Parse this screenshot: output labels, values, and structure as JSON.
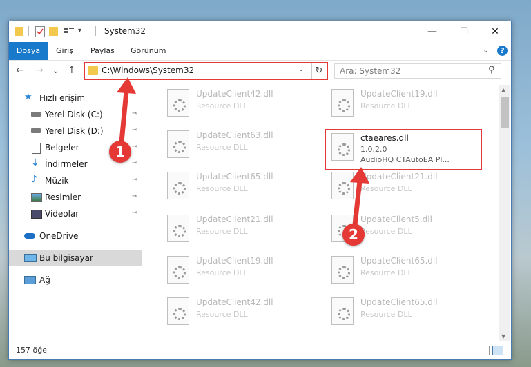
{
  "window": {
    "title": "System32",
    "qa_dropdown": "▾",
    "min": "—",
    "max": "☐",
    "close": "✕"
  },
  "ribbon": {
    "tabs": [
      "Dosya",
      "Giriş",
      "Paylaş",
      "Görünüm"
    ],
    "help": "?",
    "collapse": "⌄"
  },
  "nav": {
    "back": "←",
    "forward": "→",
    "recent": "⌄",
    "up": "↑",
    "address": "C:\\Windows\\System32",
    "address_dropdown": "⌄",
    "refresh": "↻",
    "search_placeholder": "Ara: System32",
    "search_icon": "⚲"
  },
  "sidebar": {
    "items": [
      {
        "label": "Hızlı erişim",
        "icon": "star-icon"
      },
      {
        "label": "Yerel Disk (C:)",
        "icon": "drive-icon"
      },
      {
        "label": "Yerel Disk (D:)",
        "icon": "drive-icon"
      },
      {
        "label": "Belgeler",
        "icon": "documents-icon"
      },
      {
        "label": "İndirmeler",
        "icon": "download-icon"
      },
      {
        "label": "Müzik",
        "icon": "music-icon"
      },
      {
        "label": "Resimler",
        "icon": "pictures-icon"
      },
      {
        "label": "Videolar",
        "icon": "videos-icon"
      },
      {
        "label": "OneDrive",
        "icon": "cloud-icon"
      },
      {
        "label": "Bu bilgisayar",
        "icon": "computer-icon"
      },
      {
        "label": "Ağ",
        "icon": "network-icon"
      }
    ],
    "pin_glyph": "📌"
  },
  "files": {
    "left": [
      {
        "name": "UpdateClient42.dll",
        "type": "Resource DLL"
      },
      {
        "name": "UpdateClient63.dll",
        "type": "Resource DLL"
      },
      {
        "name": "UpdateClient65.dll",
        "type": "Resource DLL"
      },
      {
        "name": "UpdateClient21.dll",
        "type": "Resource DLL"
      },
      {
        "name": "UpdateClient19.dll",
        "type": "Resource DLL"
      },
      {
        "name": "UpdateClient42.dll",
        "type": "Resource DLL"
      }
    ],
    "right": [
      {
        "name": "UpdateClient19.dll",
        "type": "Resource DLL"
      },
      {
        "name": "UpdateClient21.dll",
        "type": "Resource DLL"
      },
      {
        "name": "UpdateClient5.dll",
        "type": "Resource DLL"
      },
      {
        "name": "UpdateClient65.dll",
        "type": "Resource DLL"
      },
      {
        "name": "UpdateClient65.dll",
        "type": "Resource DLL"
      }
    ],
    "highlighted": {
      "name": "ctaeares.dll",
      "version": "1.0.2.0",
      "description": "AudioHQ CTAutoEA Pl..."
    }
  },
  "status": {
    "count": "157 öğe"
  },
  "callouts": {
    "one": "1",
    "two": "2"
  },
  "colors": {
    "accent": "#1979ca",
    "highlight": "#e53935",
    "folder": "#f2c94c"
  }
}
